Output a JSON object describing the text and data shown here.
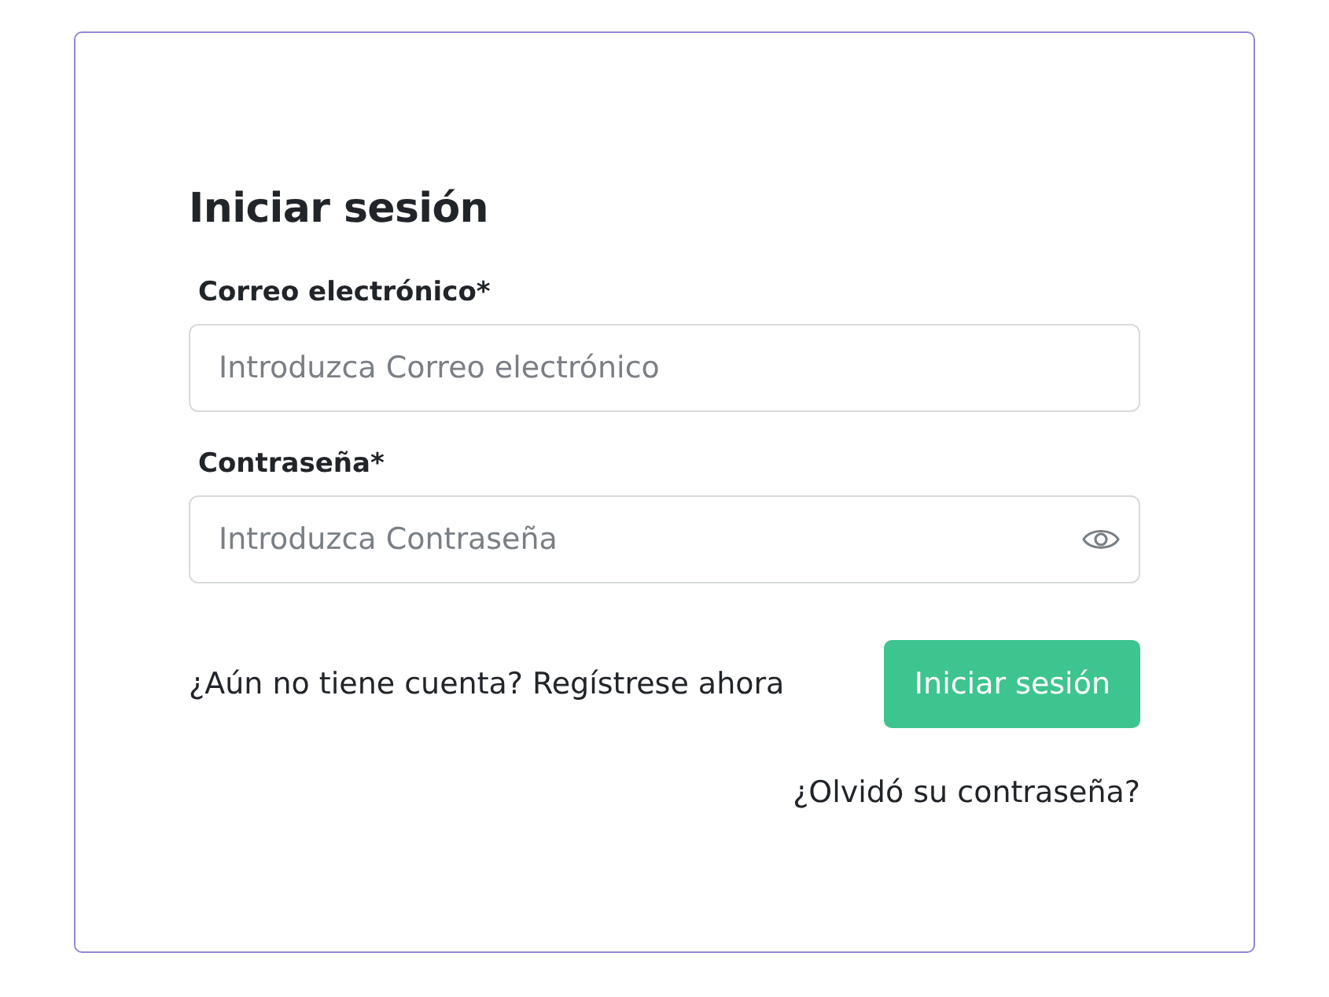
{
  "title": "Iniciar sesión",
  "fields": [
    {
      "label": "Correo electrónico*",
      "placeholder": "Introduzca Correo electrónico",
      "kind": "text"
    },
    {
      "label": "Contraseña*",
      "placeholder": "Introduzca Contraseña",
      "kind": "password"
    }
  ],
  "signup": {
    "prompt": "¿Aún no tiene cuenta?",
    "link": "Regístrese ahora"
  },
  "submit_button": "Iniciar sesión",
  "forgot_link": "¿Olvidó su contraseña?"
}
